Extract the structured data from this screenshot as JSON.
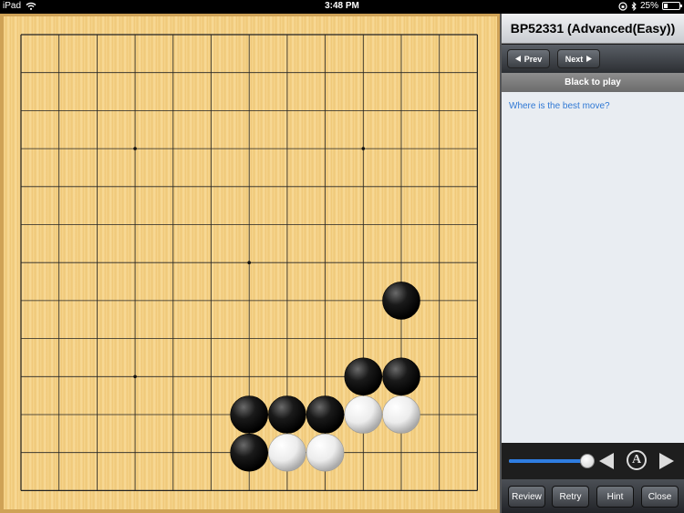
{
  "status_bar": {
    "device": "iPad",
    "time": "3:48 PM",
    "battery_percent": "25%",
    "battery_level": 0.25,
    "icons": [
      "wifi-icon",
      "rotation-lock-icon",
      "bluetooth-icon",
      "battery-icon"
    ]
  },
  "board": {
    "size": 13,
    "hoshi": [
      [
        3,
        3
      ],
      [
        9,
        3
      ],
      [
        6,
        6
      ],
      [
        3,
        9
      ],
      [
        9,
        9
      ]
    ],
    "stones": [
      {
        "col": 10,
        "row": 7,
        "color": "black"
      },
      {
        "col": 9,
        "row": 9,
        "color": "black"
      },
      {
        "col": 10,
        "row": 9,
        "color": "black"
      },
      {
        "col": 6,
        "row": 10,
        "color": "black"
      },
      {
        "col": 7,
        "row": 10,
        "color": "black"
      },
      {
        "col": 8,
        "row": 10,
        "color": "black"
      },
      {
        "col": 9,
        "row": 10,
        "color": "white"
      },
      {
        "col": 10,
        "row": 10,
        "color": "white"
      },
      {
        "col": 6,
        "row": 11,
        "color": "black"
      },
      {
        "col": 7,
        "row": 11,
        "color": "white"
      },
      {
        "col": 8,
        "row": 11,
        "color": "white"
      }
    ]
  },
  "panel": {
    "title": "BP52331 (Advanced(Easy))",
    "prev_label": "Prev",
    "next_label": "Next",
    "turn_text": "Black to play",
    "message": "Where is the best move?",
    "annotation_label": "A",
    "slider_value": 1.0,
    "buttons": {
      "review": "Review",
      "retry": "Retry",
      "hint": "Hint",
      "close": "Close"
    }
  },
  "colors": {
    "accent": "#2f7de1",
    "message_text": "#2f78d4"
  }
}
